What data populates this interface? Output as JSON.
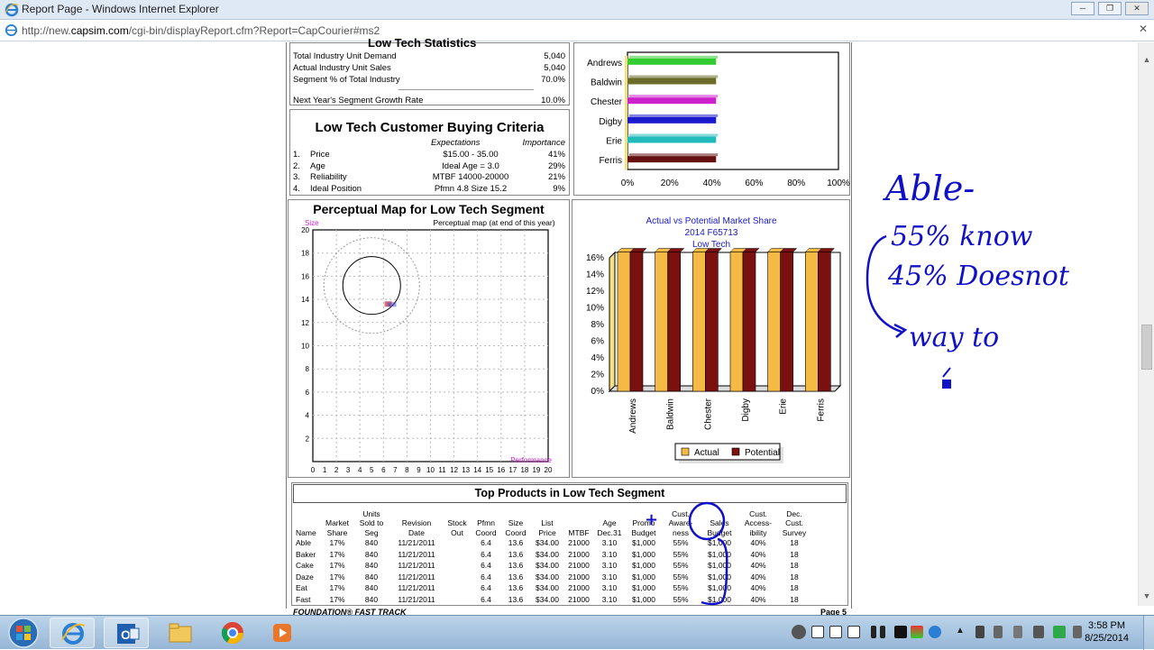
{
  "window": {
    "title": "Report Page - Windows Internet Explorer",
    "url_prefix": "http://new.",
    "url_domain": "capsim.com",
    "url_rest": "/cgi-bin/displayReport.cfm?Report=CapCourier#ms2"
  },
  "stats": {
    "heading": "Low Tech Statistics",
    "rows": [
      {
        "label": "Total Industry Unit Demand",
        "value": "5,040"
      },
      {
        "label": "Actual Industry Unit Sales",
        "value": "5,040"
      },
      {
        "label": "Segment % of Total Industry",
        "value": "70.0%"
      }
    ],
    "growth_label": "Next Year's Segment Growth Rate",
    "growth_value": "10.0%"
  },
  "criteria": {
    "title": "Low Tech Customer Buying Criteria",
    "col_expectations": "Expectations",
    "col_importance": "Importance",
    "rows": [
      {
        "num": "1.",
        "name": "Price",
        "expectation": "$15.00 - 35.00",
        "importance": "41%"
      },
      {
        "num": "2.",
        "name": "Age",
        "expectation": "Ideal Age = 3.0",
        "importance": "29%"
      },
      {
        "num": "3.",
        "name": "Reliability",
        "expectation": "MTBF 14000-20000",
        "importance": "21%"
      },
      {
        "num": "4.",
        "name": "Ideal Position",
        "expectation": "Pfmn 4.8 Size 15.2",
        "importance": "9%"
      }
    ]
  },
  "accessibility_chart": {
    "type": "bar",
    "orientation": "horizontal",
    "categories": [
      "Andrews",
      "Baldwin",
      "Chester",
      "Digby",
      "Erie",
      "Ferris"
    ],
    "values": [
      0.42,
      0.42,
      0.42,
      0.42,
      0.42,
      0.42
    ],
    "colors": [
      "#33cc33",
      "#6b6b2a",
      "#cc22cc",
      "#1a1acc",
      "#22bbbb",
      "#661111"
    ],
    "x_ticks": [
      "0%",
      "20%",
      "40%",
      "60%",
      "80%",
      "100%"
    ],
    "xlim": [
      0,
      1
    ]
  },
  "perceptual_map": {
    "title": "Perceptual Map for Low Tech Segment",
    "subtitle": "Perceptual map (at end of this year)",
    "y_label": "Size",
    "x_label": "Performance",
    "x_ticks": [
      "0",
      "1",
      "2",
      "3",
      "4",
      "5",
      "6",
      "7",
      "8",
      "9",
      "10",
      "11",
      "12",
      "13",
      "14",
      "15",
      "16",
      "17",
      "18",
      "19",
      "20"
    ],
    "y_ticks": [
      "20",
      "18",
      "16",
      "14",
      "12",
      "10",
      "8",
      "6",
      "4",
      "2"
    ],
    "ideal_center": {
      "pfmn": 5.0,
      "size": 15.2
    },
    "products_point": {
      "pfmn": 6.4,
      "size": 13.6
    }
  },
  "share_chart": {
    "title_lines": [
      "Actual vs Potential Market Share",
      "2014 F65713",
      "Low Tech"
    ],
    "type": "bar",
    "categories": [
      "Andrews",
      "Baldwin",
      "Chester",
      "Digby",
      "Erie",
      "Ferris"
    ],
    "y_ticks": [
      "16%",
      "14%",
      "12%",
      "10%",
      "8%",
      "6%",
      "4%",
      "2%",
      "0%"
    ],
    "ylim": [
      0,
      16
    ],
    "series": [
      {
        "name": "Actual",
        "color": "#f5b945",
        "values": [
          16.7,
          16.7,
          16.7,
          16.7,
          16.7,
          16.7
        ]
      },
      {
        "name": "Potential",
        "color": "#7a1010",
        "values": [
          16.7,
          16.7,
          16.7,
          16.7,
          16.7,
          16.7
        ]
      }
    ]
  },
  "products": {
    "title": "Top Products in Low Tech Segment",
    "headers": [
      [
        "Name"
      ],
      [
        "Market",
        "Share"
      ],
      [
        "Units",
        "Sold to",
        "Seg"
      ],
      [
        "Revision",
        "Date"
      ],
      [
        "Stock",
        "Out"
      ],
      [
        "Pfmn",
        "Coord"
      ],
      [
        "Size",
        "Coord"
      ],
      [
        "List",
        "Price"
      ],
      [
        "MTBF"
      ],
      [
        "Age",
        "Dec.31"
      ],
      [
        "Promo",
        "Budget"
      ],
      [
        "Cust.",
        "Aware-",
        "ness"
      ],
      [
        "Sales",
        "Budget"
      ],
      [
        "Cust.",
        "Access-",
        "ibility"
      ],
      [
        "Dec.",
        "Cust.",
        "Survey"
      ]
    ],
    "rows": [
      [
        "Able",
        "17%",
        "840",
        "11/21/2011",
        "",
        "6.4",
        "13.6",
        "$34.00",
        "21000",
        "3.10",
        "$1,000",
        "55%",
        "$1,000",
        "40%",
        "18"
      ],
      [
        "Baker",
        "17%",
        "840",
        "11/21/2011",
        "",
        "6.4",
        "13.6",
        "$34.00",
        "21000",
        "3.10",
        "$1,000",
        "55%",
        "$1,000",
        "40%",
        "18"
      ],
      [
        "Cake",
        "17%",
        "840",
        "11/21/2011",
        "",
        "6.4",
        "13.6",
        "$34.00",
        "21000",
        "3.10",
        "$1,000",
        "55%",
        "$1,000",
        "40%",
        "18"
      ],
      [
        "Daze",
        "17%",
        "840",
        "11/21/2011",
        "",
        "6.4",
        "13.6",
        "$34.00",
        "21000",
        "3.10",
        "$1,000",
        "55%",
        "$1,000",
        "40%",
        "18"
      ],
      [
        "Eat",
        "17%",
        "840",
        "11/21/2011",
        "",
        "6.4",
        "13.6",
        "$34.00",
        "21000",
        "3.10",
        "$1,000",
        "55%",
        "$1,000",
        "40%",
        "18"
      ],
      [
        "Fast",
        "17%",
        "840",
        "11/21/2011",
        "",
        "6.4",
        "13.6",
        "$34.00",
        "21000",
        "3.10",
        "$1,000",
        "55%",
        "$1,000",
        "40%",
        "18"
      ]
    ]
  },
  "footer": {
    "left": "FOUNDATION® FAST TRACK",
    "right": "Page 5"
  },
  "handwriting": {
    "line1": "Able-",
    "line2": "55% know",
    "line3": "45% Doesnot",
    "line4": "way to",
    "plus": "+"
  },
  "taskbar": {
    "time": "3:58 PM",
    "date": "8/25/2014",
    "icons": [
      "start-orb-icon",
      "internet-explorer-icon",
      "outlook-icon",
      "file-explorer-icon",
      "chrome-icon",
      "media-player-icon"
    ]
  }
}
